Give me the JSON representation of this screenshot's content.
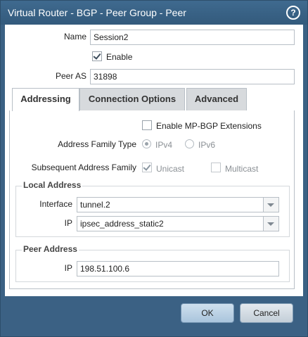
{
  "window": {
    "title": "Virtual Router - BGP - Peer Group - Peer",
    "help_icon": "?"
  },
  "form": {
    "name_label": "Name",
    "name_value": "Session2",
    "enable_label": "Enable",
    "enable_checked": true,
    "peer_as_label": "Peer AS",
    "peer_as_value": "31898"
  },
  "tabs": [
    {
      "label": "Addressing",
      "active": true
    },
    {
      "label": "Connection Options",
      "active": false
    },
    {
      "label": "Advanced",
      "active": false
    }
  ],
  "addressing": {
    "mp_bgp_label": "Enable MP-BGP Extensions",
    "mp_bgp_checked": false,
    "afi_label": "Address Family Type",
    "afi_options": [
      "IPv4",
      "IPv6"
    ],
    "afi_selected": "IPv4",
    "safi_label": "Subsequent Address Family",
    "safi_unicast_label": "Unicast",
    "safi_multicast_label": "Multicast",
    "local_address": {
      "title": "Local Address",
      "interface_label": "Interface",
      "interface_value": "tunnel.2",
      "ip_label": "IP",
      "ip_value": "ipsec_address_static2"
    },
    "peer_address": {
      "title": "Peer Address",
      "ip_label": "IP",
      "ip_value": "198.51.100.6"
    }
  },
  "footer": {
    "ok_label": "OK",
    "cancel_label": "Cancel"
  }
}
